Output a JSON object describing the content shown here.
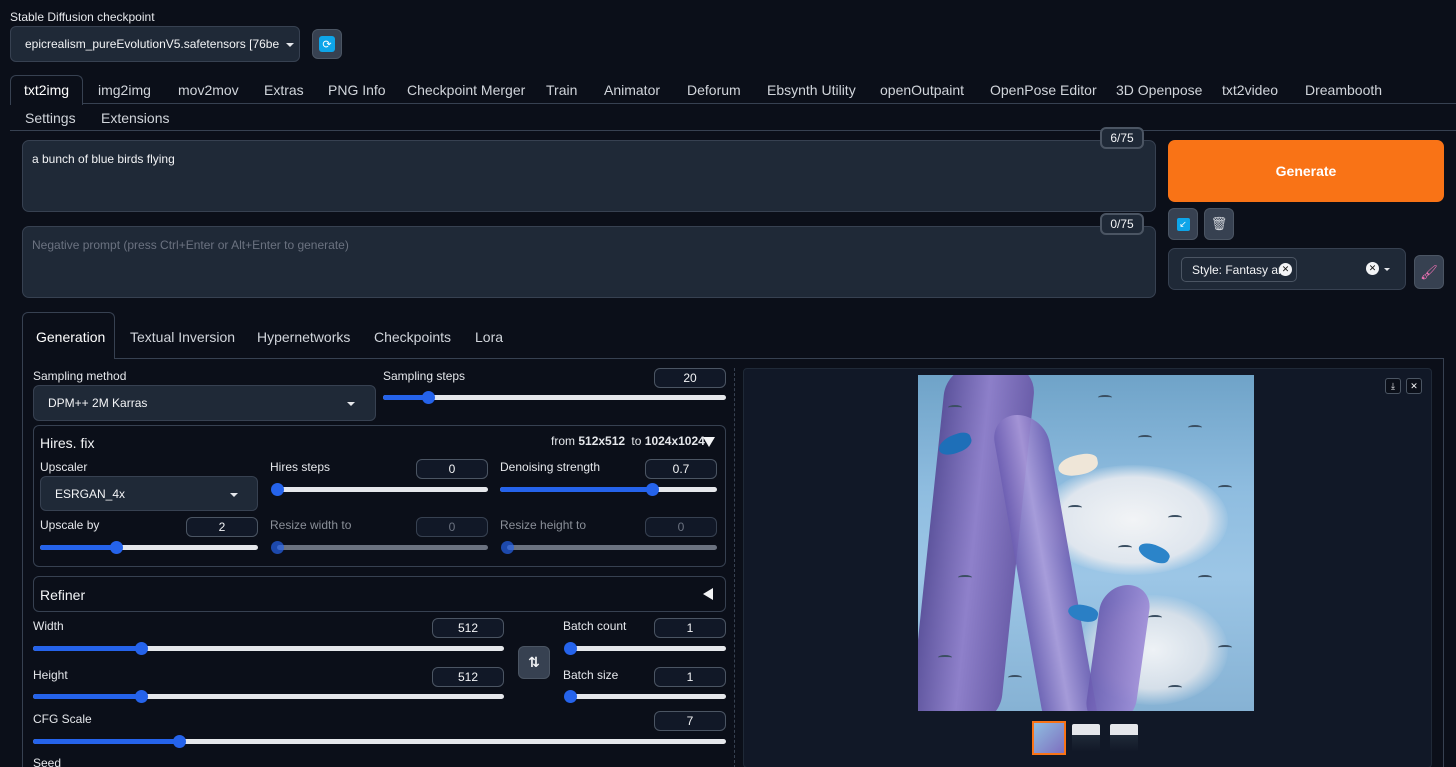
{
  "header": {
    "checkpoint_label": "Stable Diffusion checkpoint",
    "checkpoint_value": "epicrealism_pureEvolutionV5.safetensors [76be"
  },
  "tabs": [
    "txt2img",
    "img2img",
    "mov2mov",
    "Extras",
    "PNG Info",
    "Checkpoint Merger",
    "Train",
    "Animator",
    "Deforum",
    "Ebsynth Utility",
    "openOutpaint",
    "OpenPose Editor",
    "3D Openpose",
    "txt2video",
    "Dreambooth",
    "Settings",
    "Extensions"
  ],
  "prompt": {
    "text": "a bunch of blue birds flying",
    "counter": "6/75",
    "negative_placeholder": "Negative prompt (press Ctrl+Enter or Alt+Enter to generate)",
    "negative_counter": "0/75"
  },
  "generate_label": "Generate",
  "styles": {
    "tag": "Style: Fantasy art"
  },
  "subtabs": [
    "Generation",
    "Textual Inversion",
    "Hypernetworks",
    "Checkpoints",
    "Lora"
  ],
  "sampling": {
    "method_label": "Sampling method",
    "method_value": "DPM++ 2M Karras",
    "steps_label": "Sampling steps",
    "steps_value": "20",
    "steps_fraction": 0.13
  },
  "hires": {
    "title": "Hires. fix",
    "from_prefix": "from",
    "from_value": "512x512",
    "to_prefix": "to",
    "to_value": "1024x1024",
    "upscaler_label": "Upscaler",
    "upscaler_value": "ESRGAN_4x",
    "hires_steps_label": "Hires steps",
    "hires_steps_value": "0",
    "hires_steps_fraction": 0.0,
    "denoise_label": "Denoising strength",
    "denoise_value": "0.7",
    "denoise_fraction": 0.7,
    "upscale_label": "Upscale by",
    "upscale_value": "2",
    "upscale_fraction": 0.35,
    "resize_w_label": "Resize width to",
    "resize_w_value": "0",
    "resize_h_label": "Resize height to",
    "resize_h_value": "0"
  },
  "refiner": {
    "title": "Refiner"
  },
  "dims": {
    "width_label": "Width",
    "width_value": "512",
    "width_fraction": 0.23,
    "height_label": "Height",
    "height_value": "512",
    "height_fraction": 0.23,
    "batch_count_label": "Batch count",
    "batch_count_value": "1",
    "batch_count_fraction": 0.0,
    "batch_size_label": "Batch size",
    "batch_size_value": "1",
    "batch_size_fraction": 0.0
  },
  "cfg": {
    "label": "CFG Scale",
    "value": "7",
    "fraction": 0.21
  },
  "seed_label": "Seed",
  "colors": {
    "accent": "#2563eb",
    "generate": "#f97316",
    "bg": "#0b0f19",
    "panel": "#1f2937"
  }
}
